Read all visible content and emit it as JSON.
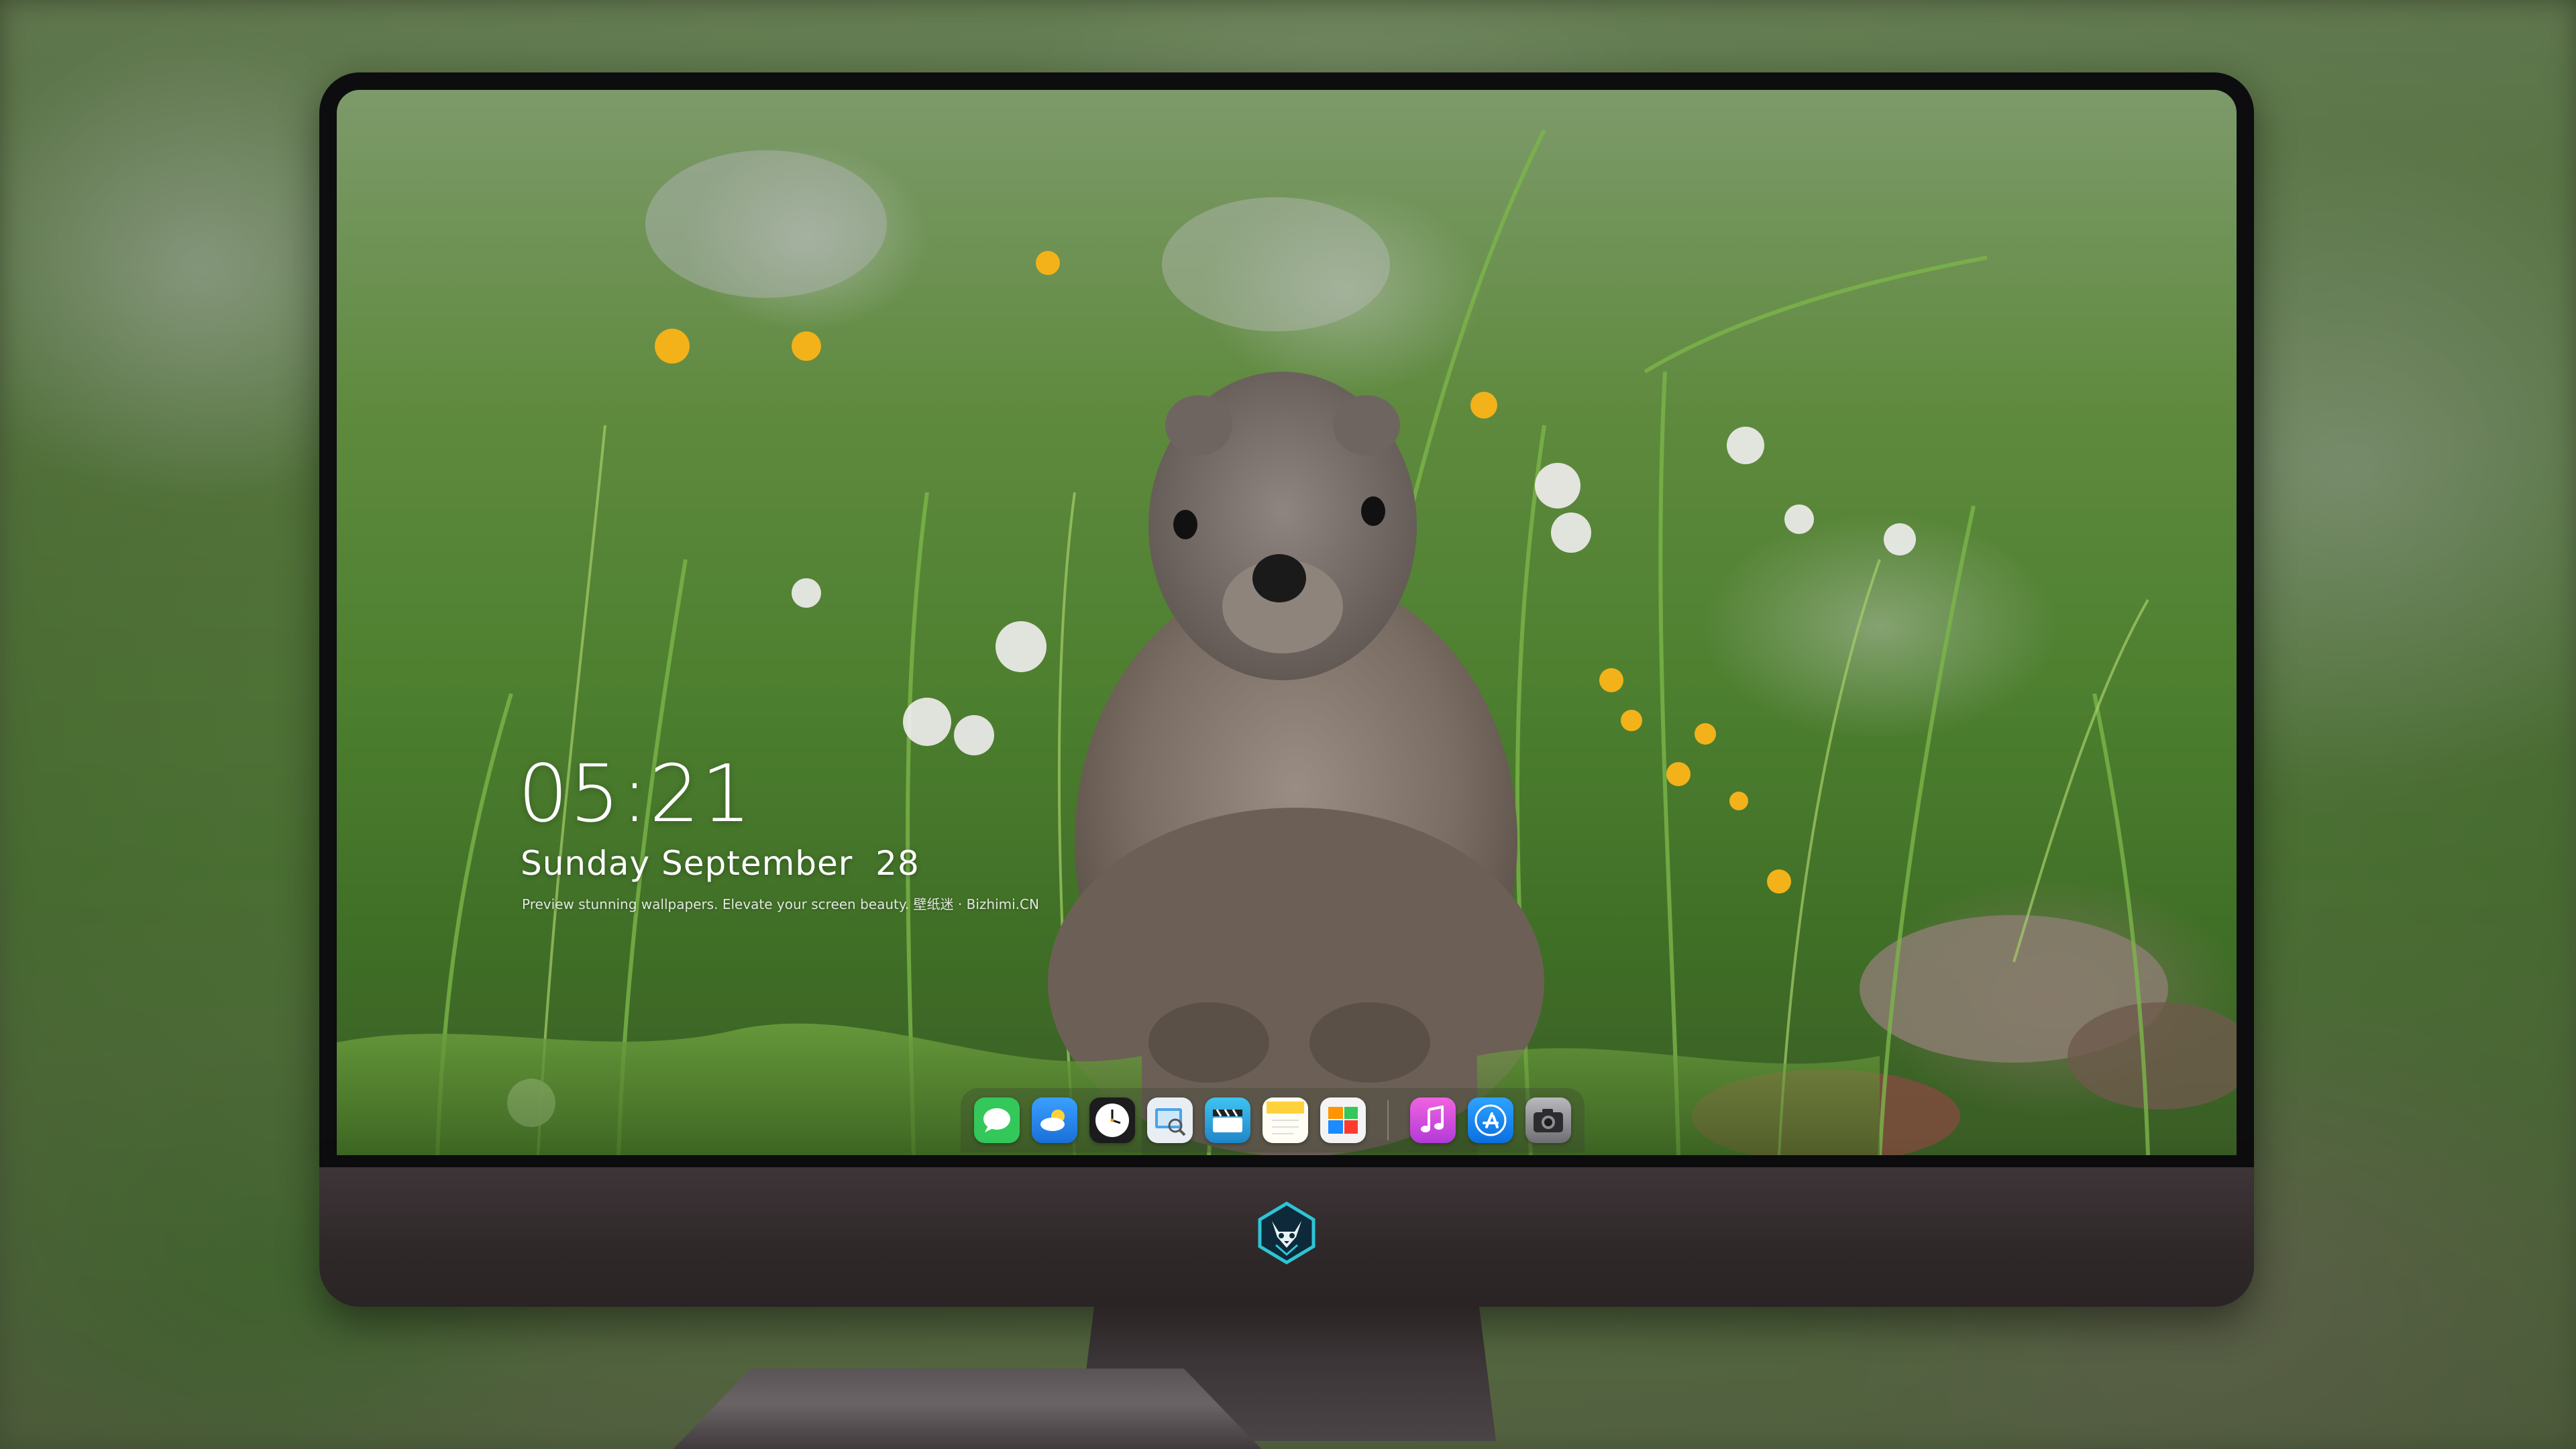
{
  "lockscreen": {
    "time": "05:21",
    "date": "Sunday September  28",
    "tagline": "Preview stunning wallpapers. Elevate your screen beauty. 壁纸迷 · Bizhimi.CN"
  },
  "dock": {
    "apps": [
      {
        "name": "messages-icon",
        "color": "#34c759"
      },
      {
        "name": "weather-icon",
        "color": "#2f8cf0"
      },
      {
        "name": "clock-icon",
        "color": "#1c1c1e"
      },
      {
        "name": "preview-icon",
        "color": "#e8eef4"
      },
      {
        "name": "video-editor-icon",
        "color": "#2aa9e0"
      },
      {
        "name": "notes-icon",
        "color": "#ffd23c"
      },
      {
        "name": "photos-icon",
        "color": "#f4f4f4"
      },
      {
        "name": "music-icon",
        "color": "#d852e8"
      },
      {
        "name": "app-store-icon",
        "color": "#1a8cff"
      },
      {
        "name": "camera-icon",
        "color": "#8e8e93"
      }
    ]
  },
  "brand": {
    "logo": "fox-mascot-icon",
    "accent": "#2ec4d6"
  }
}
